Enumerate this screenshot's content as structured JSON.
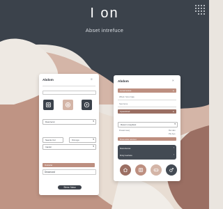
{
  "header": {
    "title": "I on",
    "subtitle": "Abset intrefuce"
  },
  "colors": {
    "dark": "#3b424b",
    "blush": "#d4b5a7",
    "clay": "#bd8f80",
    "sand": "#e8ddd3",
    "cocoa": "#9b6f63",
    "slate": "#434a53"
  },
  "left_card": {
    "title": "Abdom",
    "menu_icon": "menu-icon",
    "icons": [
      "camera-icon",
      "target-icon",
      "play-icon"
    ],
    "select1": "Dascrecut",
    "row_a_label": "Seecte Cur",
    "row_a_value": "Ost ogo",
    "row_b_label": "Inanlor",
    "bar_label": "Outrarlel",
    "field_label": "Deacnccst",
    "button_label": "Sinnc: Naso"
  },
  "right_card": {
    "title": "Abdom",
    "bar1_label": "Lunercessse",
    "bar1_note": "Whart: Scror Itgle",
    "bar2_label": "Seurreme",
    "bar3_label": "Upearstrarl",
    "select_label": "Raceri smeptlest",
    "row1_label": "Dneanmeerj",
    "row1_value": "Ret dan",
    "row2_value": "Plo Aes",
    "bar4_label": "Dnev.atrar ancmet",
    "dark_row1": "Dacontecas",
    "dark_row2": "Dnsy Ieertace",
    "icons": [
      "home-icon",
      "image-icon",
      "gamepad-icon",
      "gender-icon"
    ]
  }
}
